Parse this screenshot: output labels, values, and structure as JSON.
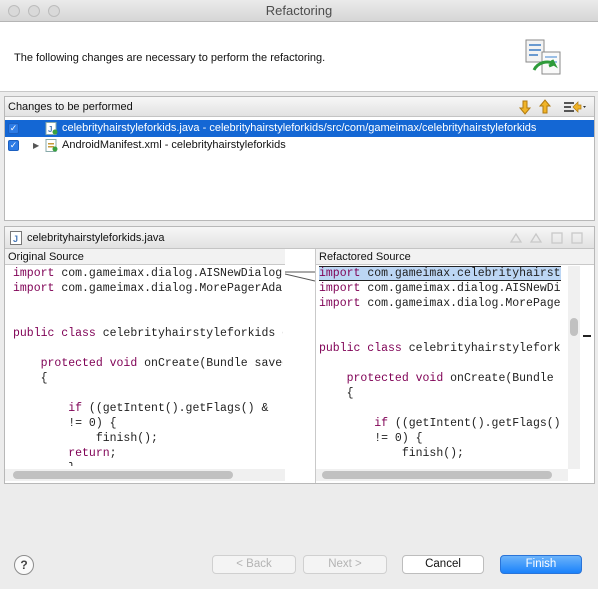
{
  "window": {
    "title": "Refactoring"
  },
  "header": {
    "message": "The following changes are necessary to perform the refactoring."
  },
  "changes": {
    "title": "Changes to be performed",
    "items": [
      {
        "label": "celebrityhairstyleforkids.java - celebrityhairstyleforkids/src/com/gameimax/celebrityhairstyleforkids",
        "checked": true,
        "selected": true,
        "icon": "java-file-icon"
      },
      {
        "label": "AndroidManifest.xml - celebrityhairstyleforkids",
        "checked": true,
        "selected": false,
        "icon": "xml-file-icon"
      }
    ]
  },
  "compare": {
    "file": "celebrityhairstyleforkids.java",
    "original_title": "Original Source",
    "refactored_title": "Refactored Source"
  },
  "buttons": {
    "help": "?",
    "back": "< Back",
    "next": "Next >",
    "cancel": "Cancel",
    "finish": "Finish"
  },
  "colors": {
    "selection": "#1467d4",
    "keyword": "#7f0055",
    "default_button": "#1a82fb",
    "checkbox": "#2c7be5"
  }
}
